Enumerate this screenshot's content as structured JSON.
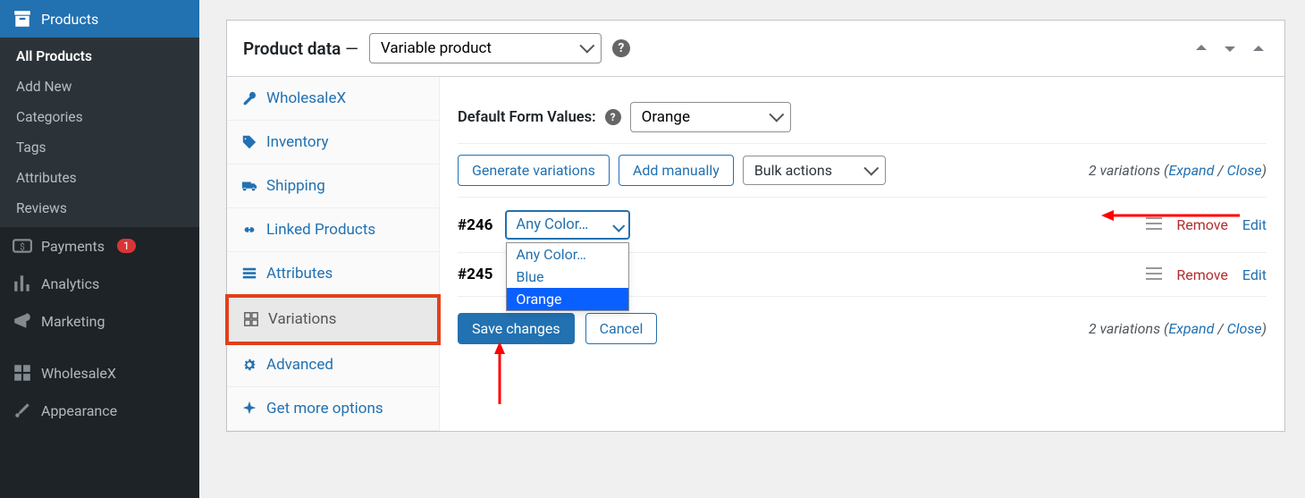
{
  "sidebar": {
    "products": "Products",
    "submenu": {
      "all_products": "All Products",
      "add_new": "Add New",
      "categories": "Categories",
      "tags": "Tags",
      "attributes": "Attributes",
      "reviews": "Reviews"
    },
    "payments": "Payments",
    "payments_badge": "1",
    "analytics": "Analytics",
    "marketing": "Marketing",
    "wholesalex": "WholesaleX",
    "appearance": "Appearance"
  },
  "panel": {
    "title": "Product data",
    "dash": "—",
    "type_selected": "Variable product"
  },
  "tabs": {
    "wholesalex": "WholesaleX",
    "inventory": "Inventory",
    "shipping": "Shipping",
    "linked_products": "Linked Products",
    "attributes": "Attributes",
    "variations": "Variations",
    "advanced": "Advanced",
    "get_more": "Get more options"
  },
  "content": {
    "default_form_label": "Default Form Values:",
    "default_form_selected": "Orange",
    "generate_btn": "Generate variations",
    "add_manually_btn": "Add manually",
    "bulk_actions": "Bulk actions",
    "count_text": "2 variations (",
    "expand": "Expand",
    "slash": " / ",
    "close": "Close",
    "paren_close": ")",
    "save_btn": "Save changes",
    "cancel_btn": "Cancel"
  },
  "variations": [
    {
      "id": "#246",
      "attr_selected": "Any Color…",
      "remove": "Remove",
      "edit": "Edit"
    },
    {
      "id": "#245",
      "attr_selected": "",
      "remove": "Remove",
      "edit": "Edit"
    }
  ],
  "dropdown_options": {
    "any": "Any Color…",
    "blue": "Blue",
    "orange": "Orange"
  }
}
